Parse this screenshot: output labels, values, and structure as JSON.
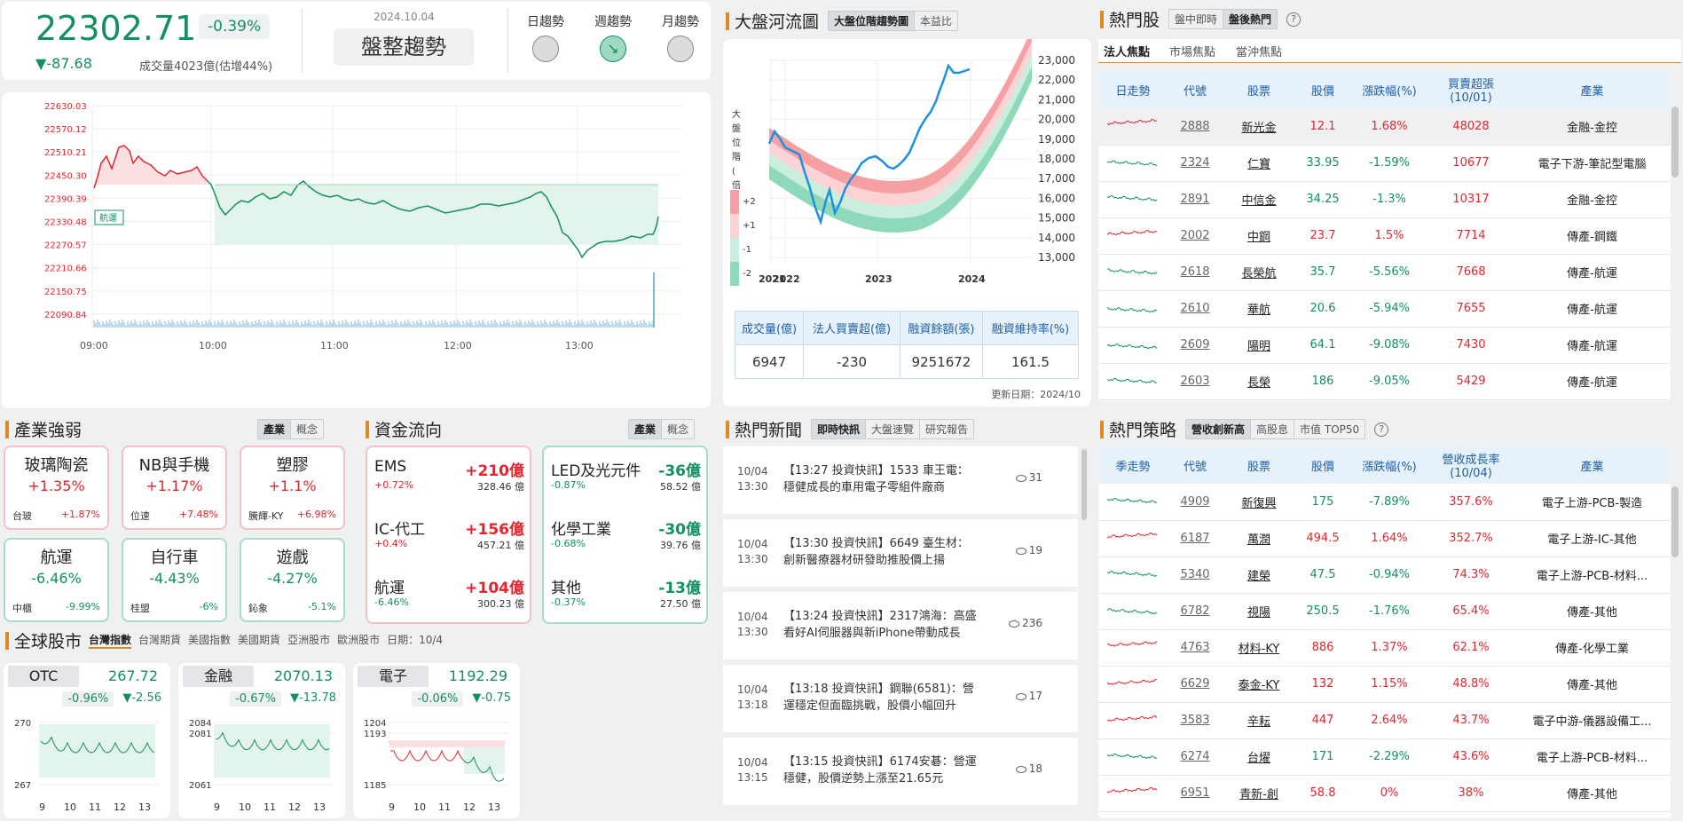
{
  "index": {
    "value": "22302.71",
    "pct": "-0.39%",
    "change": "▼-87.68",
    "volume": "成交量4023億(估增44%)",
    "date": "2024.10.04",
    "trend_label": "盤整趨勢"
  },
  "trend_tabs": [
    "日趨勢",
    "週趨勢",
    "月趨勢"
  ],
  "intraday": {
    "y_ticks": [
      "22630.03",
      "22570.12",
      "22510.21",
      "22450.30",
      "22390.39",
      "22330.48",
      "22270.57",
      "22210.66",
      "22150.75",
      "22090.84"
    ],
    "x_ticks": [
      "09:00",
      "10:00",
      "11:00",
      "12:00",
      "13:00"
    ],
    "marker": "航運"
  },
  "river": {
    "title": "大盤河流圖",
    "tabs": [
      "大盤位階趨勢圖",
      "本益比"
    ],
    "y_label": "大盤位階(倍)",
    "legend": [
      "+2",
      "+1",
      "-1",
      "-2"
    ],
    "y_ticks": [
      "23,000",
      "22,000",
      "21,000",
      "20,000",
      "19,000",
      "18,000",
      "17,000",
      "16,000",
      "15,000",
      "14,000",
      "13,000"
    ],
    "x_ticks": [
      "2021",
      "2022",
      "2023",
      "2024"
    ],
    "table_headers": [
      "成交量(億)",
      "法人買賣超(億)",
      "融資餘額(張)",
      "融資維持率(%)"
    ],
    "table_values": [
      "6947",
      "-230",
      "9251672",
      "161.5"
    ],
    "updated": "更新日期：2024/10"
  },
  "hot": {
    "title": "熱門股",
    "tabs": [
      "盤中即時",
      "盤後熱門"
    ],
    "subtabs": [
      "法人焦點",
      "市場焦點",
      "當沖焦點"
    ],
    "headers": [
      "日走勢",
      "代號",
      "股票",
      "股價",
      "漲跌幅(%)",
      "買賣超張\n(10/01)",
      "產業"
    ],
    "rows": [
      [
        "2888",
        "新光金",
        "12.1",
        "1.68%",
        "48028",
        "金融-金控",
        "up"
      ],
      [
        "2324",
        "仁寶",
        "33.95",
        "-1.59%",
        "10677",
        "電子下游-筆記型電腦",
        "dn"
      ],
      [
        "2891",
        "中信金",
        "34.25",
        "-1.3%",
        "10317",
        "金融-金控",
        "dn"
      ],
      [
        "2002",
        "中鋼",
        "23.7",
        "1.5%",
        "7714",
        "傳產-鋼鐵",
        "up"
      ],
      [
        "2618",
        "長榮航",
        "35.7",
        "-5.56%",
        "7668",
        "傳產-航運",
        "dn"
      ],
      [
        "2610",
        "華航",
        "20.6",
        "-5.94%",
        "7655",
        "傳產-航運",
        "dn"
      ],
      [
        "2609",
        "陽明",
        "64.1",
        "-9.08%",
        "7430",
        "傳產-航運",
        "dn"
      ],
      [
        "2603",
        "長榮",
        "186",
        "-9.05%",
        "5429",
        "傳產-航運",
        "dn"
      ]
    ]
  },
  "industry": {
    "title": "產業強弱",
    "tabs": [
      "產業",
      "概念"
    ],
    "items": [
      {
        "name": "玻璃陶瓷",
        "pct": "+1.35%",
        "sub": "台玻",
        "subpct": "+1.87%",
        "dir": "up"
      },
      {
        "name": "NB與手機",
        "pct": "+1.17%",
        "sub": "位速",
        "subpct": "+7.48%",
        "dir": "up"
      },
      {
        "name": "塑膠",
        "pct": "+1.1%",
        "sub": "騰輝-KY",
        "subpct": "+6.98%",
        "dir": "up"
      },
      {
        "name": "航運",
        "pct": "-6.46%",
        "sub": "中櫃",
        "subpct": "-9.99%",
        "dir": "dn"
      },
      {
        "name": "自行車",
        "pct": "-4.43%",
        "sub": "桂盟",
        "subpct": "-6%",
        "dir": "dn"
      },
      {
        "name": "遊戲",
        "pct": "-4.27%",
        "sub": "鈊象",
        "subpct": "-5.1%",
        "dir": "dn"
      }
    ]
  },
  "flow": {
    "title": "資金流向",
    "tabs": [
      "產業",
      "概念"
    ],
    "inflow": [
      {
        "name": "EMS",
        "amt": "+210億",
        "pct": "+0.72%",
        "val": "328.46 億"
      },
      {
        "name": "IC-代工",
        "amt": "+156億",
        "pct": "+0.4%",
        "val": "457.21 億"
      },
      {
        "name": "航運",
        "amt": "+104億",
        "pct": "-6.46%",
        "val": "300.23 億"
      }
    ],
    "outflow": [
      {
        "name": "LED及光元件",
        "amt": "-36億",
        "pct": "-0.87%",
        "val": "58.52 億"
      },
      {
        "name": "化學工業",
        "amt": "-30億",
        "pct": "-0.68%",
        "val": "39.76 億"
      },
      {
        "name": "其他",
        "amt": "-13億",
        "pct": "-0.37%",
        "val": "27.50 億"
      }
    ]
  },
  "news": {
    "title": "熱門新聞",
    "tabs": [
      "即時快訊",
      "大盤速覽",
      "研究報告"
    ],
    "items": [
      {
        "date": "10/04",
        "time": "13:30",
        "text": "【13:27 投資快訊】1533 車王電：穩健成長的車用電子零組件廠商",
        "views": "31"
      },
      {
        "date": "10/04",
        "time": "13:30",
        "text": "【13:30 投資快訊】6649 臺生材：創新醫療器材研發助推股價上揚",
        "views": "19"
      },
      {
        "date": "10/04",
        "time": "13:30",
        "text": "【13:24 投資快訊】2317鴻海：高盛看好AI伺服器與新iPhone帶動成長",
        "views": "236"
      },
      {
        "date": "10/04",
        "time": "13:18",
        "text": "【13:18 投資快訊】鋼聯(6581)：營運穩定但面臨挑戰，股價小幅回升",
        "views": "17"
      },
      {
        "date": "10/04",
        "time": "13:15",
        "text": "【13:15 投資快訊】6174安碁：營運穩健，股價逆勢上漲至21.65元",
        "views": "18"
      }
    ]
  },
  "strategy": {
    "title": "熱門策略",
    "tabs": [
      "營收創新高",
      "高股息",
      "市值 TOP50"
    ],
    "headers": [
      "季走勢",
      "代號",
      "股票",
      "股價",
      "漲跌幅(%)",
      "營收成長率\n(10/04)",
      "產業"
    ],
    "rows": [
      [
        "4909",
        "新復興",
        "175",
        "-7.89%",
        "357.6%",
        "電子上游-PCB-製造",
        "dn"
      ],
      [
        "6187",
        "萬潤",
        "494.5",
        "1.64%",
        "352.7%",
        "電子上游-IC-其他",
        "up"
      ],
      [
        "5340",
        "建榮",
        "47.5",
        "-0.94%",
        "74.3%",
        "電子上游-PCB-材料...",
        "dn"
      ],
      [
        "6782",
        "視陽",
        "250.5",
        "-1.76%",
        "65.4%",
        "傳產-其他",
        "dn"
      ],
      [
        "4763",
        "材料-KY",
        "886",
        "1.37%",
        "62.1%",
        "傳產-化學工業",
        "up"
      ],
      [
        "6629",
        "泰金-KY",
        "132",
        "1.15%",
        "48.8%",
        "傳產-其他",
        "up"
      ],
      [
        "3583",
        "辛耘",
        "447",
        "2.64%",
        "43.7%",
        "電子中游-儀器設備工...",
        "up"
      ],
      [
        "6274",
        "台燿",
        "171",
        "-2.29%",
        "43.6%",
        "電子上游-PCB-材料...",
        "dn"
      ],
      [
        "6951",
        "青新-創",
        "58.8",
        "0%",
        "38%",
        "傳產-其他",
        "up"
      ]
    ]
  },
  "global": {
    "title": "全球股市",
    "tabs": [
      "台灣指數",
      "台灣期貨",
      "美國指數",
      "美國期貨",
      "亞洲股市",
      "歐洲股市"
    ],
    "date": "日期：10/4",
    "minis": [
      {
        "name": "OTC",
        "value": "267.72",
        "pct": "-0.96%",
        "chg": "▼-2.56",
        "y": [
          "270",
          "267"
        ]
      },
      {
        "name": "金融",
        "value": "2070.13",
        "pct": "-0.67%",
        "chg": "▼-13.78",
        "y": [
          "2084",
          "2081",
          "2061"
        ]
      },
      {
        "name": "電子",
        "value": "1192.29",
        "pct": "-0.06%",
        "chg": "▼-0.75",
        "y": [
          "1204",
          "1193",
          "1185"
        ]
      }
    ],
    "x": [
      "9",
      "10",
      "11",
      "12",
      "13"
    ]
  },
  "colors": {
    "up": "#e3262d",
    "down": "#13905f",
    "accent": "#e08a1e",
    "header_bg": "#e6f1fa"
  }
}
